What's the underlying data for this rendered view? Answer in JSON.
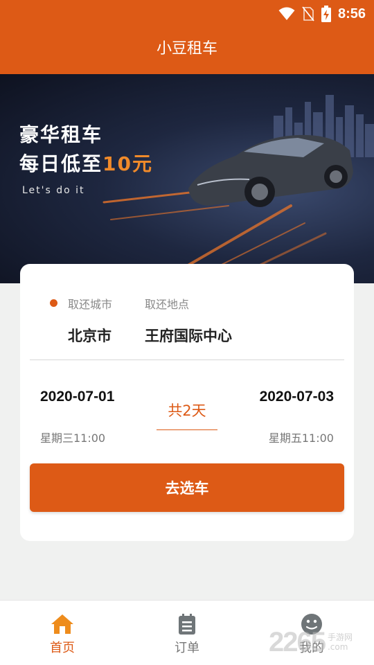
{
  "status_bar": {
    "time": "8:56",
    "icons": [
      "wifi-icon",
      "no-sim-icon",
      "battery-charging-icon"
    ]
  },
  "header": {
    "title": "小豆租车"
  },
  "banner": {
    "headline": "豪华租车",
    "subline_prefix": "每日低至",
    "subline_price": "10元",
    "tagline": "Let's do it"
  },
  "booking": {
    "city_label": "取还城市",
    "city_value": "北京市",
    "location_label": "取还地点",
    "location_value": "王府国际中心",
    "pickup_date": "2020-07-01",
    "pickup_time": "星期三11:00",
    "duration": "共2天",
    "return_date": "2020-07-03",
    "return_time": "星期五11:00",
    "submit_label": "去选车"
  },
  "bottom_nav": {
    "items": [
      {
        "label": "首页",
        "icon": "home-icon",
        "active": true
      },
      {
        "label": "订单",
        "icon": "order-icon",
        "active": false
      },
      {
        "label": "我的",
        "icon": "profile-icon",
        "active": false
      }
    ]
  },
  "watermark": {
    "number": "2265",
    "site": "手游网",
    "domain": ".com"
  },
  "colors": {
    "accent": "#dd5a16",
    "background": "#f0f1f0",
    "banner_highlight": "#f08a2a"
  }
}
